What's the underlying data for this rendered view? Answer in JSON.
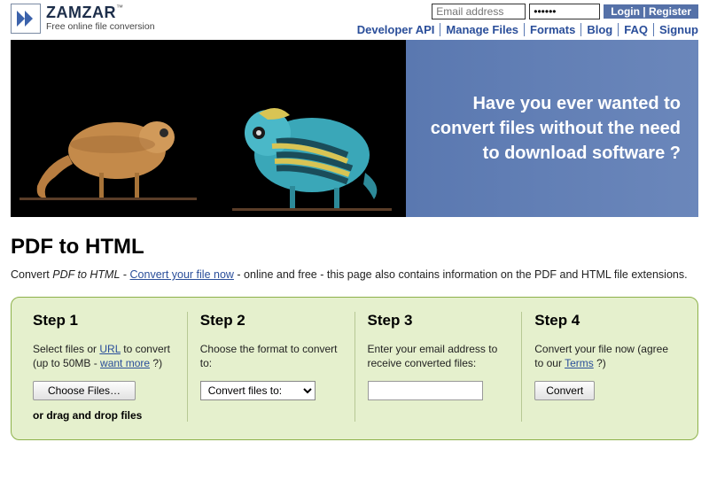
{
  "brand": {
    "name": "ZAMZAR",
    "tagline": "Free online file conversion",
    "tm": "™"
  },
  "login": {
    "email_placeholder": "Email address",
    "password_value": "••••••",
    "login_label": "Login",
    "sep": " | ",
    "register_label": "Register"
  },
  "nav": [
    "Developer API",
    "Manage Files",
    "Formats",
    "Blog",
    "FAQ",
    "Signup"
  ],
  "hero": {
    "text": "Have you ever wanted to convert files without the need to download software ?"
  },
  "page": {
    "title": "PDF to HTML",
    "sub_pre": "Convert ",
    "sub_em": "PDF to HTML",
    "sub_mid": " - ",
    "sub_link": "Convert your file now",
    "sub_post": " - online and free - this page also contains information on the PDF and HTML file extensions."
  },
  "steps": {
    "s1": {
      "title": "Step 1",
      "text_a": "Select files or ",
      "url": "URL",
      "text_b": " to convert (up to 50MB - ",
      "want": "want more",
      "text_c": " ?)",
      "choose": "Choose Files…",
      "drag": "or drag and drop files"
    },
    "s2": {
      "title": "Step 2",
      "text": "Choose the format to convert to:",
      "select": "Convert files to:"
    },
    "s3": {
      "title": "Step 3",
      "text": "Enter your email address to receive converted files:"
    },
    "s4": {
      "title": "Step 4",
      "text_a": "Convert your file now (agree to our ",
      "terms": "Terms",
      "text_b": " ?)",
      "button": "Convert"
    }
  }
}
